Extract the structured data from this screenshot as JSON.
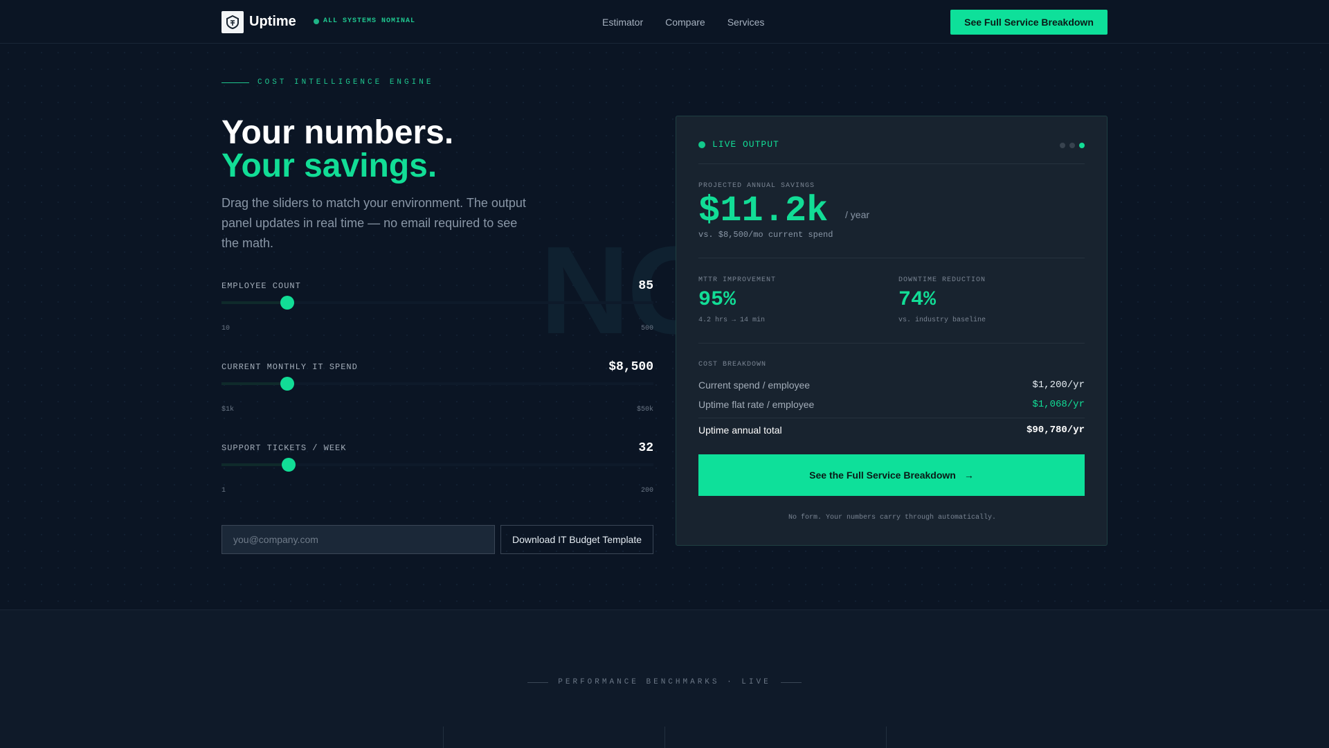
{
  "nav": {
    "brand": "Uptime",
    "status": "ALL SYSTEMS NOMINAL",
    "links": [
      "Estimator",
      "Compare",
      "Services"
    ],
    "cta": "See Full Service Breakdown"
  },
  "hero": {
    "eyebrow": "COST INTELLIGENCE ENGINE",
    "title_line1": "Your numbers.",
    "title_line2": "Your savings.",
    "lede": "Drag the sliders to match your environment. The output panel updates in real time — no email required to see the math.",
    "watermark": "NO"
  },
  "sliders": [
    {
      "label": "EMPLOYEE COUNT",
      "value": "85",
      "min": "10",
      "max": "500",
      "fraction": 0.153
    },
    {
      "label": "CURRENT MONTHLY IT SPEND",
      "value": "$8,500",
      "min": "$1k",
      "max": "$50k",
      "fraction": 0.153
    },
    {
      "label": "SUPPORT TICKETS / WEEK",
      "value": "32",
      "min": "1",
      "max": "200",
      "fraction": 0.156
    }
  ],
  "form": {
    "email_placeholder": "you@company.com",
    "download_label": "Download IT Budget Template"
  },
  "card": {
    "live_label": "LIVE OUTPUT",
    "savings_label": "PROJECTED ANNUAL SAVINGS",
    "savings_value": "$11.2k",
    "per_year": "/ year",
    "vs_text": "vs. $8,500/mo current spend",
    "mttr_label": "MTTR IMPROVEMENT",
    "mttr_value": "95%",
    "mttr_sub": "4.2 hrs → 14 min",
    "downtime_label": "DOWNTIME REDUCTION",
    "downtime_value": "74%",
    "downtime_sub": "vs. industry baseline",
    "breakdown_label": "COST BREAKDOWN",
    "rows": [
      {
        "label": "Current spend / employee",
        "value": "$1,200/yr"
      },
      {
        "label": "Uptime flat rate / employee",
        "value": "$1,068/yr"
      },
      {
        "label": "Uptime annual total",
        "value": "$90,780/yr"
      }
    ],
    "cta": "See the Full Service Breakdown",
    "cta_arrow": "→",
    "note": "No form. Your numbers carry through automatically."
  },
  "benchmarks": {
    "title": "PERFORMANCE BENCHMARKS · LIVE"
  },
  "colors": {
    "accent": "#12dd96",
    "background": "#0b1524",
    "card": "#18232f"
  }
}
